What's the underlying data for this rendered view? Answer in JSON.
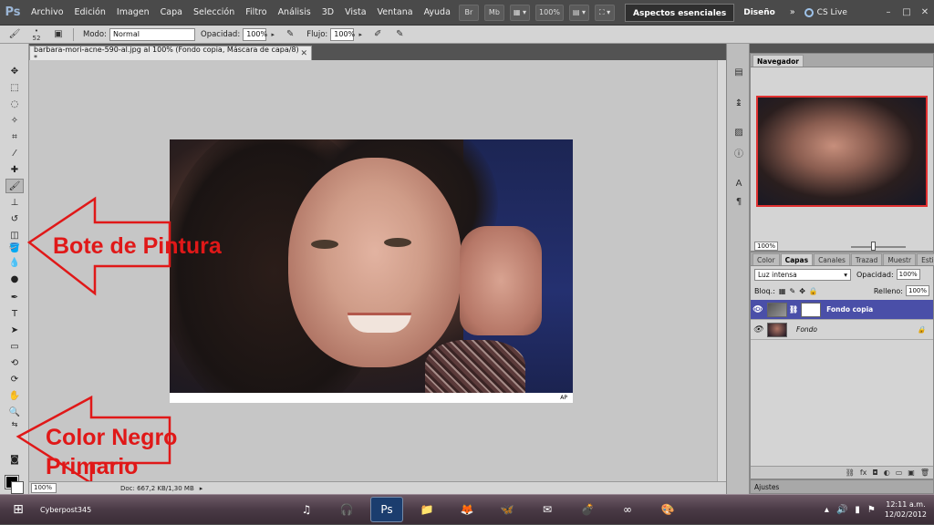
{
  "menubar": {
    "logo": "Ps",
    "items": [
      "Archivo",
      "Edición",
      "Imagen",
      "Capa",
      "Selección",
      "Filtro",
      "Análisis",
      "3D",
      "Vista",
      "Ventana",
      "Ayuda"
    ],
    "bridge_label": "Br",
    "minibridge_label": "Mb",
    "zoom_value": "100%",
    "workspace_essentials": "Aspectos esenciales",
    "workspace_design": "Diseño",
    "more": "»",
    "cslive_label": "CS Live",
    "window_controls": [
      "–",
      "□",
      "✕"
    ]
  },
  "options_bar": {
    "brush_size": "52",
    "mode_label": "Modo:",
    "mode_value": "Normal",
    "opacity_label": "Opacidad:",
    "opacity_value": "100%",
    "flow_label": "Flujo:",
    "flow_value": "100%"
  },
  "document": {
    "tab_title": "barbara-mori-acne-590-al.jpg al 100% (Fondo copia, Máscara de capa/8) *",
    "photo_watermark": "AP",
    "status_zoom": "100%",
    "status_doc": "Doc: 667,2 KB/1,30 MB"
  },
  "annotations": {
    "paint_bucket": "Bote de Pintura",
    "black_color_line1": "Color Negro",
    "black_color_line2": "Primario",
    "arrow_color": "#e01818"
  },
  "navigator": {
    "tab": "Navegador",
    "zoom": "100%"
  },
  "layers": {
    "tabs": [
      "Color",
      "Capas",
      "Canales",
      "Trazad",
      "Muestr",
      "Estilos"
    ],
    "active_tab": "Capas",
    "blend_mode": "Luz intensa",
    "opacity_label": "Opacidad:",
    "opacity_value": "100%",
    "lock_label": "Bloq.:",
    "fill_label": "Relleno:",
    "fill_value": "100%",
    "rows": [
      {
        "name": "Fondo copia",
        "selected": true
      },
      {
        "name": "Fondo",
        "selected": false
      }
    ],
    "selected_color": "#4a4fa8"
  },
  "adjustments": {
    "tab": "Ajustes"
  },
  "taskbar": {
    "user": "Cyberpost345",
    "time": "12:11 a.m.",
    "date": "12/02/2012"
  }
}
